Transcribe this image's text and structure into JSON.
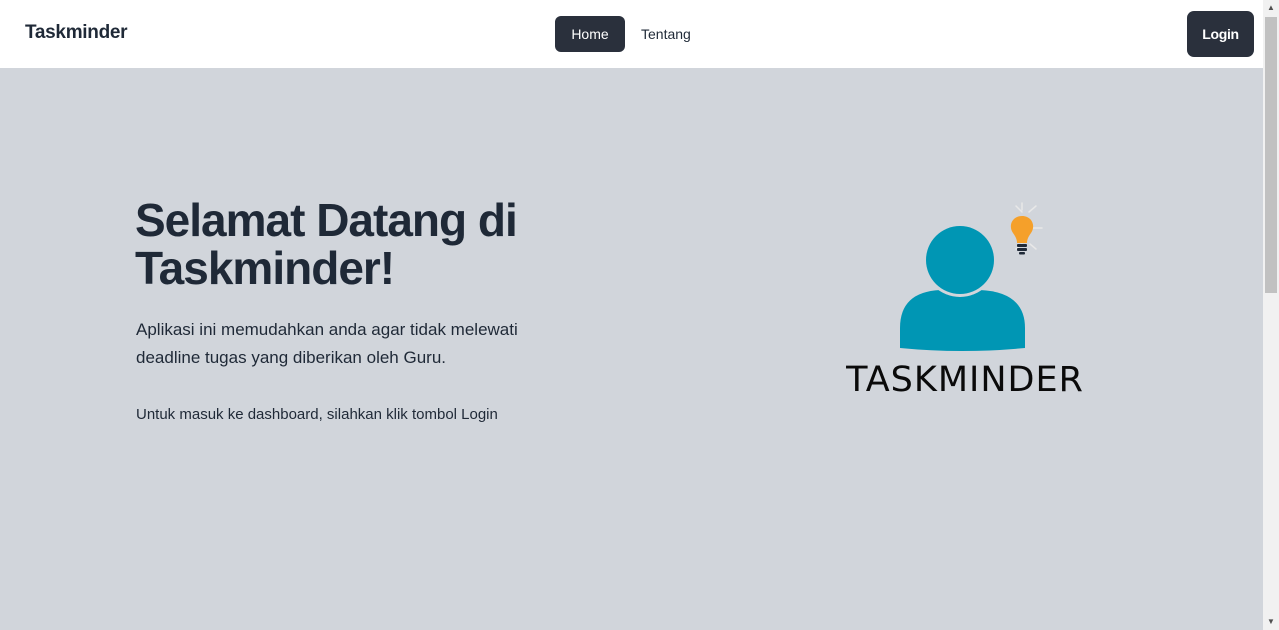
{
  "navbar": {
    "brand": "Taskminder",
    "links": [
      {
        "label": "Home",
        "active": true
      },
      {
        "label": "Tentang",
        "active": false
      }
    ],
    "login_label": "Login"
  },
  "hero": {
    "title": "Selamat Datang di Taskminder!",
    "description": "Aplikasi ini memudahkan anda agar tidak melewati deadline tugas yang diberikan oleh Guru.",
    "note": "Untuk masuk ke dashboard, silahkan klik tombol Login"
  },
  "logo": {
    "text": "TASKMINDER",
    "icon": "person-with-lightbulb-icon",
    "colors": {
      "person": "#0096b4",
      "bulb": "#f5a02a",
      "text": "#0a0a0a"
    }
  },
  "colors": {
    "background": "#d1d5db",
    "navbar": "#ffffff",
    "button_dark": "#2a303c",
    "text": "#1f2937"
  },
  "scrollbar": {
    "up_icon": "▲",
    "down_icon": "▼"
  }
}
